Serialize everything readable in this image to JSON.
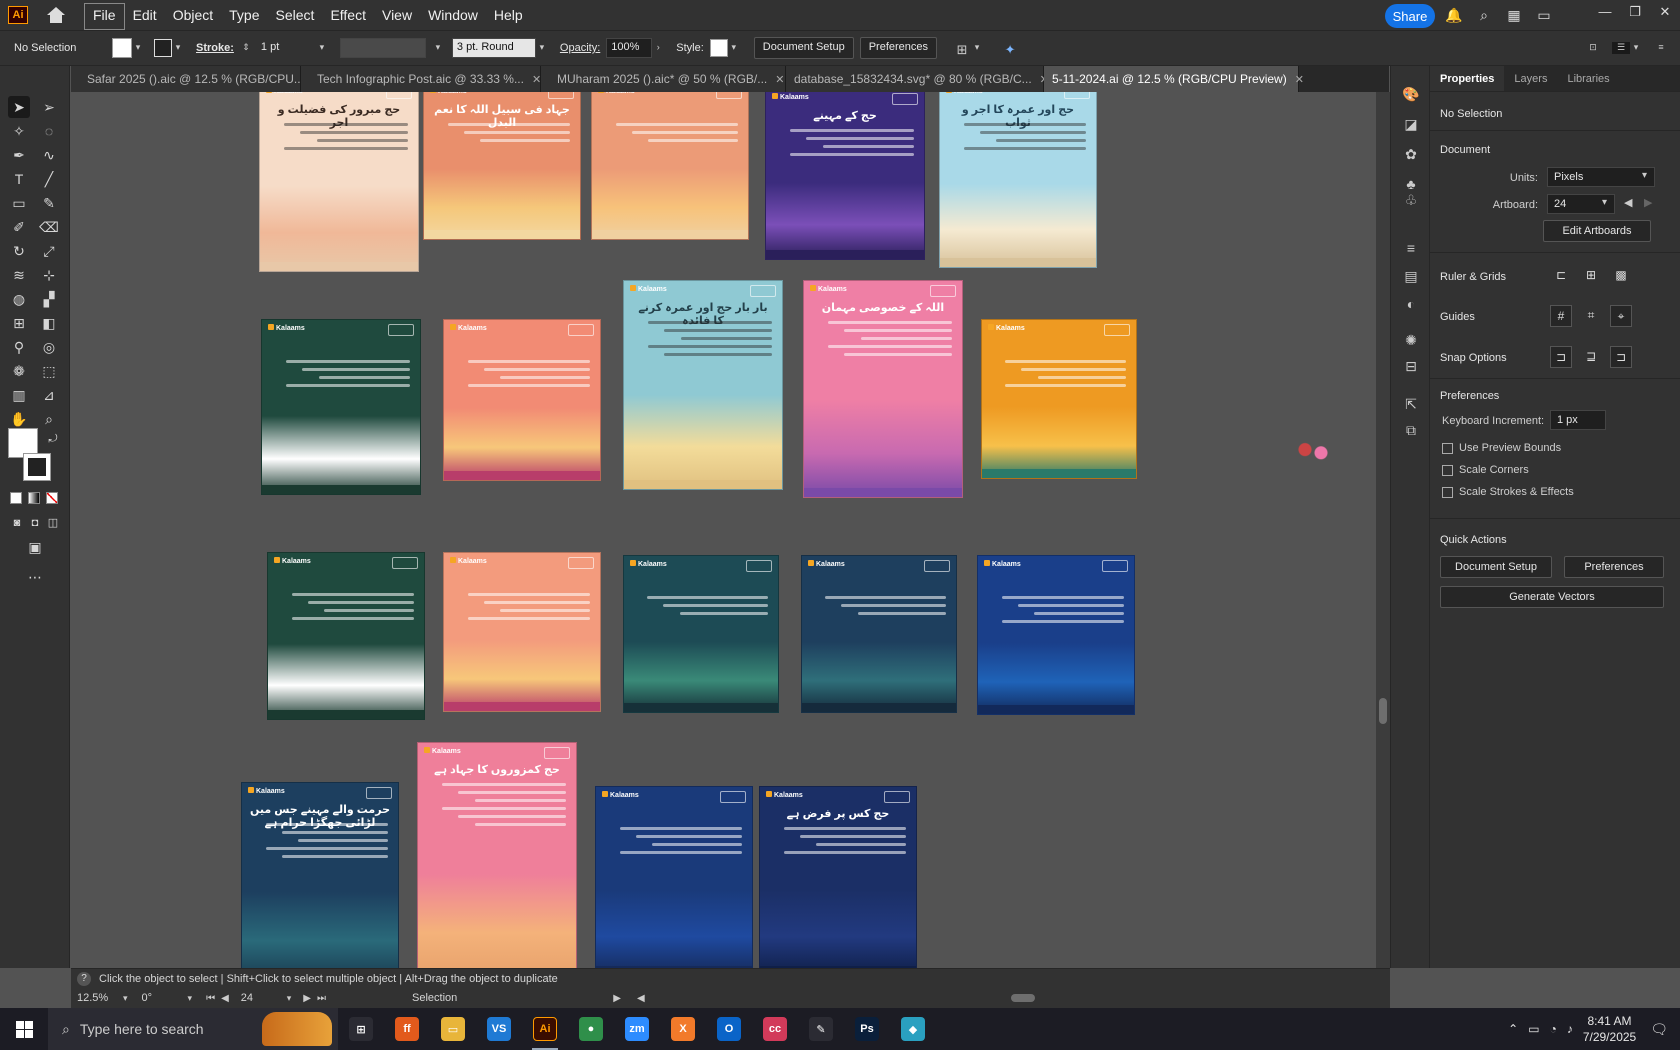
{
  "menubar": {
    "items": [
      "File",
      "Edit",
      "Object",
      "Type",
      "Select",
      "Effect",
      "View",
      "Window",
      "Help"
    ],
    "share_label": "Share",
    "app_badge": "Ai"
  },
  "controlbar": {
    "selection": "No Selection",
    "stroke_label": "Stroke:",
    "stroke_value": "1 pt",
    "brush_value": "3 pt. Round",
    "opacity_label": "Opacity:",
    "opacity_value": "100%",
    "style_label": "Style:",
    "document_setup": "Document Setup",
    "preferences": "Preferences"
  },
  "tabs": [
    {
      "label": "Safar 2025 ().aic @ 12.5 % (RGB/CPU...",
      "active": false
    },
    {
      "label": "Tech Infographic Post.aic @ 33.33 %...",
      "active": false
    },
    {
      "label": "MUharam 2025 ().aic* @ 50 % (RGB/...",
      "active": false
    },
    {
      "label": "database_15832434.svg* @ 80 % (RGB/C...",
      "active": false
    },
    {
      "label": "5-11-2024.ai @ 12.5 % (RGB/CPU Preview)",
      "active": true
    }
  ],
  "panel": {
    "tabs": [
      "Properties",
      "Layers",
      "Libraries"
    ],
    "no_selection": "No Selection",
    "document_label": "Document",
    "units_label": "Units:",
    "units_value": "Pixels",
    "artboard_label": "Artboard:",
    "artboard_value": "24",
    "edit_artboards": "Edit Artboards",
    "ruler_grids": "Ruler & Grids",
    "guides": "Guides",
    "snap_options": "Snap Options",
    "preferences_label": "Preferences",
    "keyboard_increment_label": "Keyboard Increment:",
    "keyboard_increment_value": "1 px",
    "use_preview_bounds": "Use Preview Bounds",
    "scale_corners": "Scale Corners",
    "scale_strokes": "Scale Strokes & Effects",
    "quick_actions": "Quick Actions",
    "document_setup_btn": "Document Setup",
    "preferences_btn": "Preferences",
    "generate_vectors": "Generate Vectors"
  },
  "statusbar": {
    "hint": "Click the object to select  |  Shift+Click to select multiple object  |  Alt+Drag the object to duplicate",
    "zoom": "12.5%",
    "rotation": "0°",
    "artboard": "24",
    "tool": "Selection"
  },
  "artboards": [
    {
      "title": "حج مبرور کی فضیلت و اجر",
      "bg": "#f6dcc8",
      "text": "#3a2a22",
      "scene": "#f0b898",
      "ground": "#e8c8a8"
    },
    {
      "title": "جہاد فی سبیل اللہ کا نعم البدل",
      "bg": "#e98f6c",
      "text": "#ffffff",
      "scene": "#f5c77a",
      "ground": "#f3d7a0"
    },
    {
      "title": "",
      "bg": "#ec9b77",
      "text": "#ffffff",
      "scene": "#f7c27a",
      "ground": "#f0d0a0"
    },
    {
      "title": "حج کے مہینے",
      "bg": "#3b2c7d",
      "text": "#ffffff",
      "scene": "#7b4fb8",
      "ground": "#2a1f5a"
    },
    {
      "title": "حج اور عمرہ کا اجر و ثواب",
      "bg": "#a9d9e8",
      "text": "#23465a",
      "scene": "#f5ead2",
      "ground": "#d8c29a"
    },
    {
      "title": "",
      "bg": "#1f4a3e",
      "text": "#ffffff",
      "scene": "#ffffff",
      "ground": "#1a3a30"
    },
    {
      "title": "",
      "bg": "#f28b74",
      "text": "#ffffff",
      "scene": "#f7c77a",
      "ground": "#b83d6a"
    },
    {
      "title": "بار بار حج اور عمرہ کرنے کا فائدہ",
      "bg": "#8fc9d3",
      "text": "#23404a",
      "scene": "#f3dc9a",
      "ground": "#e0c080"
    },
    {
      "title": "اللہ کے خصوصی مہمان",
      "bg": "#ef7fa5",
      "text": "#ffffff",
      "scene": "#c86ab0",
      "ground": "#7a4aa8"
    },
    {
      "title": "",
      "bg": "#ee9a22",
      "text": "#ffffff",
      "scene": "#f7c04a",
      "ground": "#2a7a6a"
    },
    {
      "title": "",
      "bg": "#1f4a3e",
      "text": "#ffffff",
      "scene": "#ffffff",
      "ground": "#1a3a30"
    },
    {
      "title": "",
      "bg": "#f39b7d",
      "text": "#ffffff",
      "scene": "#f7c77a",
      "ground": "#b83d6a"
    },
    {
      "title": "",
      "bg": "#1d4b55",
      "text": "#ffffff",
      "scene": "#3a8a78",
      "ground": "#163038"
    },
    {
      "title": "",
      "bg": "#1e3f5e",
      "text": "#ffffff",
      "scene": "#2f6f7a",
      "ground": "#152a3c"
    },
    {
      "title": "",
      "bg": "#1a3f8a",
      "text": "#ffffff",
      "scene": "#1f63b8",
      "ground": "#12295a"
    },
    {
      "title": "حج کمزوروں کا جہاد ہے",
      "bg": "#ef7f9a",
      "text": "#ffffff",
      "scene": "#f4b27a",
      "ground": "#e6a06a"
    },
    {
      "title": "حرمت والے مہینے جس میں لڑائی جھگڑا حرام ہے",
      "bg": "#1d3f5f",
      "text": "#ffffff",
      "scene": "#2a6a7a",
      "ground": "#1a3a50"
    },
    {
      "title": "",
      "bg": "#1a3a7a",
      "text": "#ffffff",
      "scene": "#1f4aa0",
      "ground": "#152a5a"
    },
    {
      "title": "حج کس پر فرض ہے",
      "bg": "#1b2f66",
      "text": "#ffffff",
      "scene": "#223a80",
      "ground": "#0f1f48"
    }
  ],
  "taskbar": {
    "search_placeholder": "Type here to search",
    "apps": [
      {
        "name": "Task View",
        "label": "⊞",
        "color": "#2b2b33"
      },
      {
        "name": "Firefox",
        "label": "ff",
        "color": "#e25a1c"
      },
      {
        "name": "File Explorer",
        "label": "▭",
        "color": "#e8b53a"
      },
      {
        "name": "VS Code",
        "label": "VS",
        "color": "#1f7ad4"
      },
      {
        "name": "Illustrator",
        "label": "Ai",
        "color": "#3a0d00"
      },
      {
        "name": "Chrome",
        "label": "●",
        "color": "#2f8f4a"
      },
      {
        "name": "Zoom",
        "label": "zm",
        "color": "#2d8cff"
      },
      {
        "name": "XAMPP",
        "label": "X",
        "color": "#f27a2a"
      },
      {
        "name": "Outlook",
        "label": "O",
        "color": "#0a64c8"
      },
      {
        "name": "Creative Cloud",
        "label": "cc",
        "color": "#d23a5a"
      },
      {
        "name": "Pen",
        "label": "✎",
        "color": "#2b2b33"
      },
      {
        "name": "Photoshop",
        "label": "Ps",
        "color": "#0a1f3a"
      },
      {
        "name": "App",
        "label": "◆",
        "color": "#2aa0c0"
      }
    ],
    "time": "8:41 AM",
    "date": "7/29/2025"
  }
}
